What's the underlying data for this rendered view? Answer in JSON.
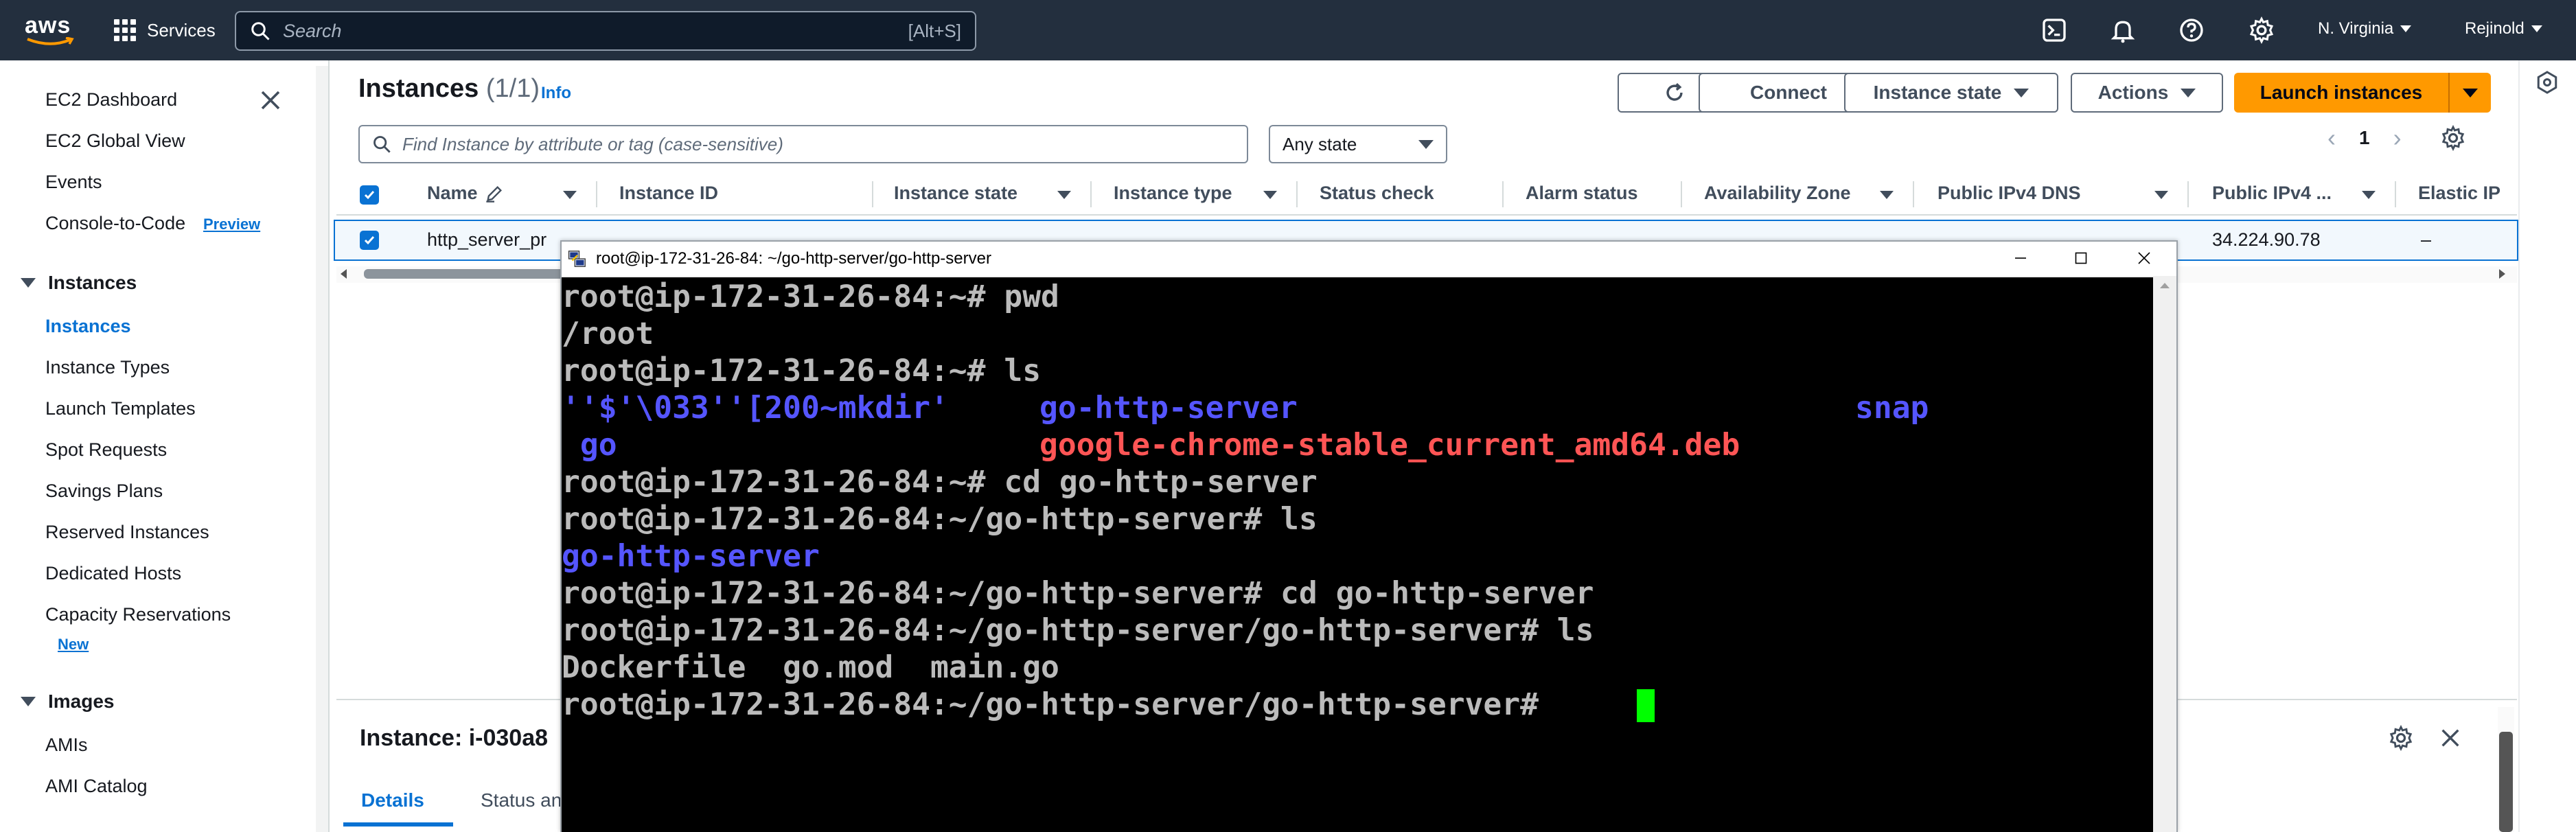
{
  "topnav": {
    "logo": "aws",
    "services_label": "Services",
    "search_placeholder": "Search",
    "search_shortcut": "[Alt+S]",
    "region": "N. Virginia",
    "user": "Rejinold",
    "icons": [
      "cloudshell-icon",
      "bell-icon",
      "help-icon",
      "gear-icon"
    ]
  },
  "sidebar": {
    "top_items": [
      "EC2 Dashboard",
      "EC2 Global View",
      "Events",
      "Console-to-Code"
    ],
    "console_badge": "Preview",
    "sections": {
      "instances": {
        "title": "Instances",
        "items": [
          "Instances",
          "Instance Types",
          "Launch Templates",
          "Spot Requests",
          "Savings Plans",
          "Reserved Instances",
          "Dedicated Hosts",
          "Capacity Reservations"
        ],
        "active": "Instances",
        "new_badge": "New"
      },
      "images": {
        "title": "Images",
        "items": [
          "AMIs",
          "AMI Catalog"
        ]
      }
    }
  },
  "main": {
    "title": "Instances",
    "count": "(1/1)",
    "info": "Info",
    "buttons": {
      "connect": "Connect",
      "instance_state": "Instance state",
      "actions": "Actions",
      "launch": "Launch instances"
    },
    "filter_placeholder": "Find Instance by attribute or tag (case-sensitive)",
    "state_filter": "Any state",
    "page": "1",
    "columns": [
      "Name",
      "Instance ID",
      "Instance state",
      "Instance type",
      "Status check",
      "Alarm status",
      "Availability Zone",
      "Public IPv4 DNS",
      "Public IPv4 ...",
      "Elastic IP"
    ],
    "row": {
      "name": "http_server_pr",
      "public_ipv4": "34.224.90.78",
      "elastic_ip": "–"
    }
  },
  "details": {
    "title": "Instance: i-030a8",
    "tabs": [
      "Details",
      "Status an"
    ]
  },
  "terminal": {
    "title": "root@ip-172-31-26-84: ~/go-http-server/go-http-server",
    "lines": [
      {
        "text": "root@ip-172-31-26-84:~# pwd"
      },
      {
        "text": "/root"
      },
      {
        "text": "root@ip-172-31-26-84:~# ls"
      },
      {
        "cols": [
          {
            "t": "''$'\\033''[200~mkdir'",
            "c": "blue"
          },
          {
            "t": "go-http-server",
            "c": "blue"
          },
          {
            "t": "snap",
            "c": "blue"
          }
        ]
      },
      {
        "cols": [
          {
            "t": " go",
            "c": "blue"
          },
          {
            "t": "google-chrome-stable_current_amd64.deb",
            "c": "red"
          }
        ]
      },
      {
        "text": "root@ip-172-31-26-84:~# cd go-http-server"
      },
      {
        "text": "root@ip-172-31-26-84:~/go-http-server# ls"
      },
      {
        "text": "go-http-server",
        "c": "blue"
      },
      {
        "text": "root@ip-172-31-26-84:~/go-http-server# cd go-http-server"
      },
      {
        "text": "root@ip-172-31-26-84:~/go-http-server/go-http-server# ls"
      },
      {
        "text": "Dockerfile  go.mod  main.go"
      },
      {
        "text": "root@ip-172-31-26-84:~/go-http-server/go-http-server# "
      }
    ]
  },
  "colors": {
    "nav_bg": "#232f3e",
    "link_blue": "#0972d3",
    "launch_orange": "#ff9900",
    "term_blue": "#5555ff",
    "term_red": "#ff5555",
    "cursor_green": "#00ff00"
  }
}
